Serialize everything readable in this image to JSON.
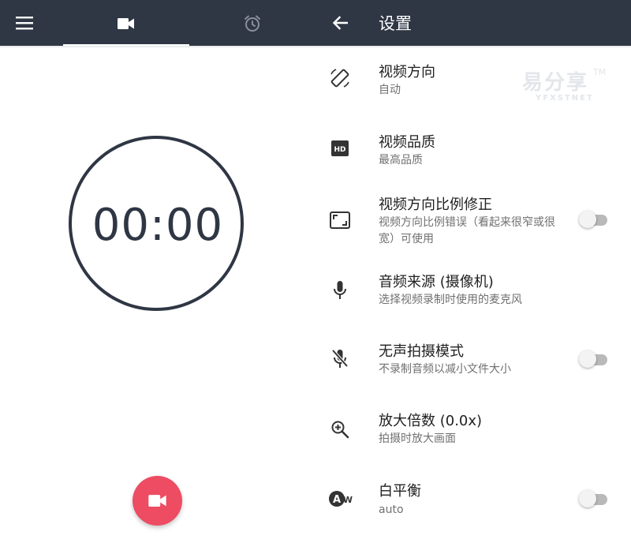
{
  "left_panel": {
    "tabs": [
      {
        "icon": "videocam-icon",
        "active": true
      },
      {
        "icon": "alarm-icon",
        "active": false
      }
    ],
    "timer": "00:00",
    "record_button_icon": "videocam-icon"
  },
  "settings": {
    "title": "设置",
    "items": [
      {
        "icon": "screen-rotation-icon",
        "title": "视频方向",
        "subtitle": "自动"
      },
      {
        "icon": "hd-icon",
        "title": "视频品质",
        "subtitle": "最高品质"
      },
      {
        "icon": "aspect-ratio-icon",
        "title": "视频方向比例修正",
        "subtitle": "视频方向比例错误（看起来很窄或很宽）可使用",
        "toggle": false
      },
      {
        "icon": "mic-icon",
        "title": "音频来源 (摄像机)",
        "subtitle": "选择视频录制时使用的麦克风"
      },
      {
        "icon": "mic-off-icon",
        "title": "无声拍摄模式",
        "subtitle": "不录制音频以减小文件大小",
        "toggle": false
      },
      {
        "icon": "zoom-in-icon",
        "title": "放大倍数 (0.0x)",
        "subtitle": "拍摄时放大画面"
      },
      {
        "icon": "white-balance-auto-icon",
        "title": "白平衡",
        "subtitle": "auto",
        "toggle": false
      }
    ]
  },
  "watermark": {
    "text": "易分享",
    "tm": "TM",
    "sub": "YFXSTNET"
  },
  "colors": {
    "toolbar": "#2f3644",
    "accent": "#ed4c63",
    "timer": "#2f3644"
  }
}
